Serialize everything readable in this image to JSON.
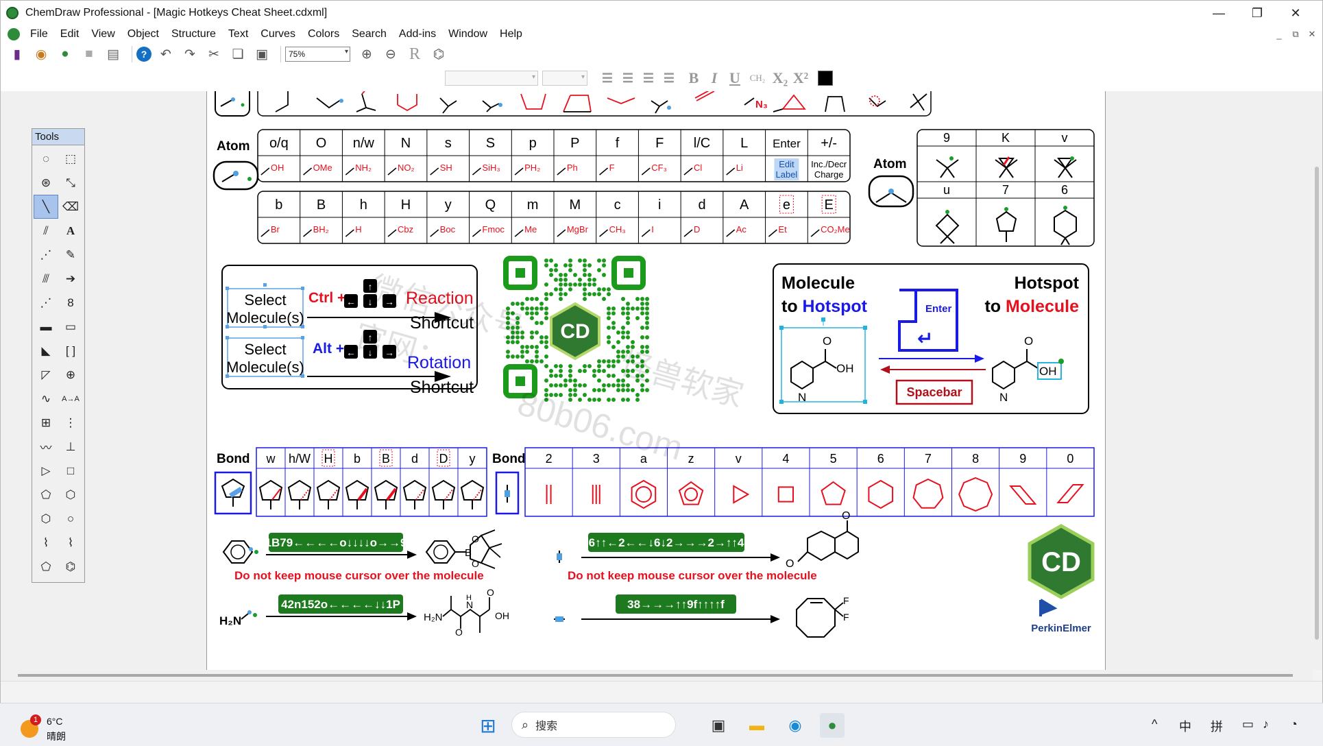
{
  "window": {
    "title": "ChemDraw Professional - [Magic Hotkeys Cheat Sheet.cdxml]"
  },
  "menu": [
    "File",
    "Edit",
    "View",
    "Object",
    "Structure",
    "Text",
    "Curves",
    "Colors",
    "Search",
    "Add-ins",
    "Window",
    "Help"
  ],
  "toolbar": {
    "zoom": "75%"
  },
  "tools_panel": {
    "title": "Tools"
  },
  "sheet": {
    "atom_label_left": "Atom",
    "atom_label_right": "Atom",
    "atom_row1_keys": [
      "o/q",
      "O",
      "n/w",
      "N",
      "s",
      "S",
      "p",
      "P",
      "f",
      "F",
      "l/C",
      "L",
      "Enter",
      "+/-"
    ],
    "atom_row1_groups": [
      "OH",
      "OMe",
      "NH₂",
      "NO₂",
      "SH",
      "SiH₃",
      "PH₂",
      "Ph",
      "F",
      "CF₃",
      "Cl",
      "Li",
      "Edit Label",
      "Inc./Decr Charge"
    ],
    "atom_row2_keys": [
      "b",
      "B",
      "h",
      "H",
      "y",
      "Q",
      "m",
      "M",
      "c",
      "i",
      "d",
      "A",
      "e",
      "E"
    ],
    "atom_row2_groups": [
      "Br",
      "BH₂",
      "H",
      "Cbz",
      "Boc",
      "Fmoc",
      "Me",
      "MgBr",
      "CH₃",
      "I",
      "D",
      "Ac",
      "Et",
      "CO₂Me"
    ],
    "ring_keys_top": [
      "9",
      "K",
      "v"
    ],
    "ring_keys_bottom": [
      "u",
      "7",
      "6"
    ],
    "select_label": "Select",
    "molecule_label": "Molecule(s)",
    "ctrl_plus": "Ctrl +",
    "alt_plus": "Alt +",
    "reaction": "Reaction",
    "rotation": "Rotation",
    "shortcut": "Shortcut",
    "hotspot_left_1": "Molecule",
    "hotspot_left_2a": "to ",
    "hotspot_left_2b": "Hotspot",
    "hotspot_right_1": "Hotspot",
    "hotspot_right_2a": "to ",
    "hotspot_right_2b": "Molecule",
    "enter_key": "Enter",
    "spacebar": "Spacebar",
    "oh_label": "OH",
    "n_label": "N",
    "o_label": "O",
    "bond_label_left": "Bond",
    "bond_label_right": "Bond",
    "bond_keys": [
      "w",
      "h/W",
      "H",
      "b",
      "B",
      "d",
      "D",
      "y"
    ],
    "ring_keys": [
      "2",
      "3",
      "a",
      "z",
      "v",
      "4",
      "5",
      "6",
      "7",
      "8",
      "9",
      "0"
    ],
    "seq1": "1B79←←←←o↓↓↓↓o→→9",
    "seq2": "6↑↑←2←←↓6↓2→→→2→↑↑4",
    "seq3": "42n152o←←←←↓↓1P",
    "seq4": "38→→→↑↑9f↑↑↑↑f",
    "warning": "Do not keep mouse cursor over the molecule",
    "h2n": "H₂N",
    "perkinelmer": "PerkinElmer",
    "watermark_1": "微信公众号",
    "watermark_2": "官网：",
    "watermark_3": "怪兽软家",
    "watermark_4": "80b06.com"
  },
  "taskbar": {
    "weather_temp": "6°C",
    "weather_cond": "晴朗",
    "weather_badge": "1",
    "search_placeholder": "搜索",
    "ime_1": "中",
    "ime_2": "拼"
  },
  "colors": {
    "red": "#e8101e",
    "blue": "#1a1ae6",
    "green": "#1e7a1e",
    "darkred": "#b0101a"
  }
}
